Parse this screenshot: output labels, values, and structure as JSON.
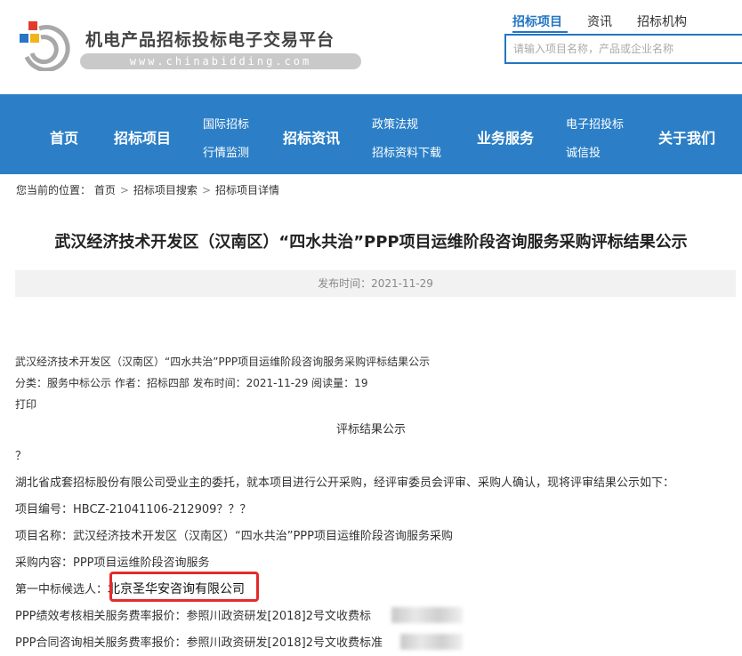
{
  "header": {
    "site_name": "机电产品招标投标电子交易平台",
    "site_url": "www.chinabidding.com",
    "search_tabs": [
      "招标项目",
      "资讯",
      "招标机构"
    ],
    "search_placeholder": "请输入项目名称，产品或企业名称"
  },
  "nav": {
    "home": "首页",
    "projects": "招标项目",
    "intl_bidding": "国际招标",
    "market_watch": "行情监测",
    "news": "招标资讯",
    "policy": "政策法规",
    "downloads": "招标资料下载",
    "services": "业务服务",
    "e_bidding": "电子招投标",
    "credit": "诚信投",
    "about": "关于我们"
  },
  "breadcrumb": {
    "prefix": "您当前的位置：",
    "items": [
      "首页",
      "招标项目搜索",
      "招标项目详情"
    ],
    "separator": ">"
  },
  "article": {
    "title": "武汉经济技术开发区（汉南区）“四水共治”PPP项目运维阶段咨询服务采购评标结果公示",
    "publish_time": "发布时间：2021-11-29",
    "subtitle": "武汉经济技术开发区（汉南区）“四水共治”PPP项目运维阶段咨询服务采购评标结果公示",
    "meta": "分类：服务中标公示 作者：招标四部 发布时间：2021-11-29 阅读量：19",
    "print": "打印",
    "heading": "评标结果公示",
    "q": "？",
    "intro": "湖北省成套招标股份有限公司受业主的委托，就本项目进行公开采购，经评审委员会评审、采购人确认，现将评审结果公示如下：",
    "project_no": "项目编号：HBCZ-21041106-212909？？？",
    "project_name": "项目名称：武汉经济技术开发区（汉南区）“四水共治”PPP项目运维阶段咨询服务采购",
    "content": "采购内容：PPP项目运维阶段咨询服务",
    "winner_label": "第一中标候选人：",
    "winner_name": "北京圣华安咨询有限公司",
    "fee1": "PPP绩效考核相关服务费率报价：参照川政资研发[2018]2号文收费标",
    "fee2": "PPP合同咨询相关服务费率报价：参照川政资研发[2018]2号文收费标准"
  },
  "colors": {
    "brand_blue": "#2c7fc7",
    "highlight_red": "#e52a2a"
  }
}
